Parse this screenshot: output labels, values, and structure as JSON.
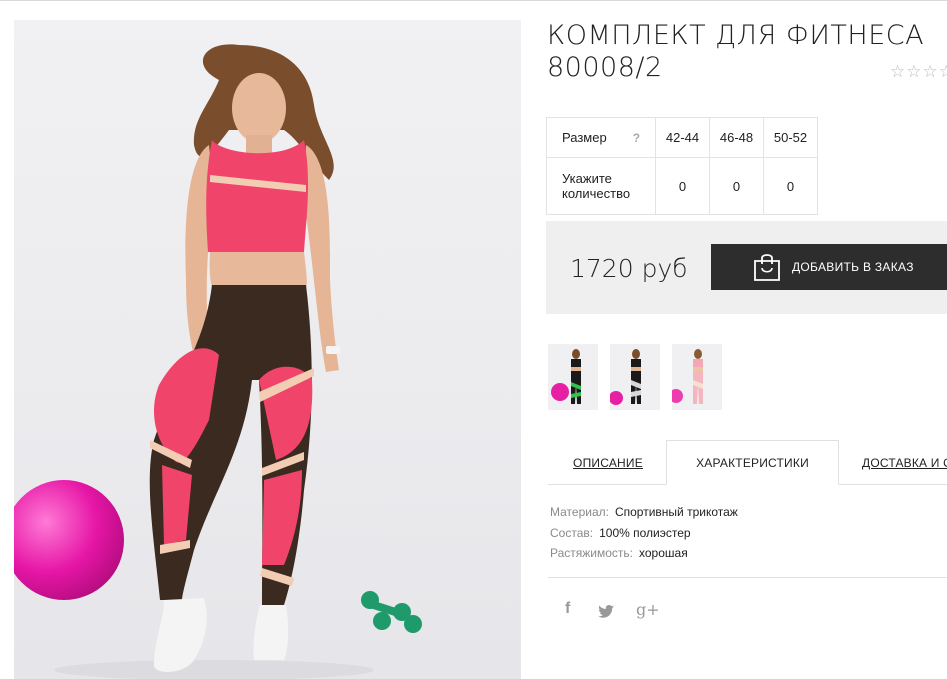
{
  "product": {
    "title": "КОМПЛЕКТ ДЛЯ ФИТНЕСА 80008/2",
    "rating_stars": "☆☆☆☆"
  },
  "size_table": {
    "size_label": "Размер",
    "help": "?",
    "sizes": [
      "42-44",
      "46-48",
      "50-52"
    ],
    "quantity_label": "Укажите количество",
    "quantities": [
      "0",
      "0",
      "0"
    ]
  },
  "purchase": {
    "price": "1720 руб",
    "add_button": "ДОБАВИТЬ В ЗАКАЗ"
  },
  "thumbnails": [
    "green-black set",
    "black-grey set",
    "pink-beige set"
  ],
  "tabs": {
    "description": "ОПИСАНИЕ",
    "characteristics": "ХАРАКТЕРИСТИКИ",
    "delivery": "ДОСТАВКА И ОПЛАТА"
  },
  "characteristics": [
    {
      "key": "Материал:",
      "value": "Спортивный трикотаж"
    },
    {
      "key": "Состав:",
      "value": "100% полиэстер"
    },
    {
      "key": "Растяжимость:",
      "value": "хорошая"
    }
  ],
  "social": {
    "facebook": "f",
    "twitter": "🐦",
    "google": "g+"
  },
  "colors": {
    "accent_pink": "#f0446a",
    "button": "#2d2d2d",
    "leggings": "#3b2a20"
  }
}
